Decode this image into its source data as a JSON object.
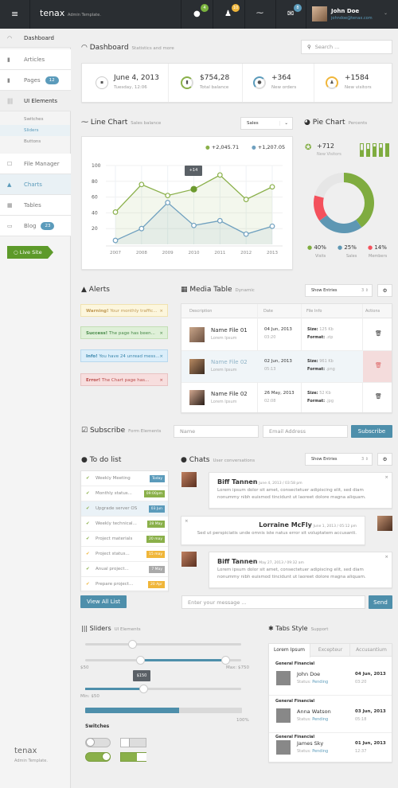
{
  "topbar": {
    "brand": "tenax",
    "brand_sub": "Admin Template.",
    "notif_badges": [
      "4",
      "10",
      "",
      "8"
    ],
    "user_name": "John Doe",
    "user_email": "johndoe@tenax.com"
  },
  "sidebar": {
    "items": [
      {
        "label": "Dashboard"
      },
      {
        "label": "Articles"
      },
      {
        "label": "Pages",
        "badge": "12"
      },
      {
        "label": "UI Elements"
      },
      {
        "label": "File Manager"
      },
      {
        "label": "Charts"
      },
      {
        "label": "Tables"
      },
      {
        "label": "Blog",
        "badge": "23"
      }
    ],
    "subitems": [
      "Switches",
      "Sliders",
      "Buttons"
    ],
    "live_site": "Live Site",
    "footer_brand": "tenax",
    "footer_sub": "Admin Template."
  },
  "dashboard": {
    "title": "Dashboard",
    "subtitle": "Statistics and more",
    "search_placeholder": "Search ...",
    "stats": [
      {
        "value": "June 4, 2013",
        "label": "Tuesday, 12:06"
      },
      {
        "value": "$754,28",
        "label": "Total balance"
      },
      {
        "value": "+364",
        "label": "New orders"
      },
      {
        "value": "+1584",
        "label": "New visitors"
      }
    ]
  },
  "line_chart": {
    "title": "Line Chart",
    "subtitle": "Sales balance",
    "select": "Sales",
    "legend": [
      "+2,045.71",
      "+1,207.05"
    ],
    "tooltip": "+14"
  },
  "chart_data": {
    "type": "line",
    "x": [
      "2007",
      "2008",
      "2009",
      "2010",
      "2011",
      "2012",
      "2013"
    ],
    "yticks": [
      20,
      40,
      60,
      80,
      100
    ],
    "ylim": [
      0,
      100
    ],
    "series": [
      {
        "color": "#8ab04a",
        "values": [
          41,
          76,
          62,
          70,
          88,
          57,
          73
        ]
      },
      {
        "color": "#6fa0bf",
        "values": [
          5,
          20,
          53,
          24,
          30,
          13,
          23
        ]
      }
    ],
    "highlight": {
      "series": 0,
      "index": 3
    }
  },
  "pie_chart": {
    "title": "Pie Chart",
    "subtitle": "Percents",
    "visitors_value": "+712",
    "visitors_label": "New Visitors",
    "mini_bars": [
      0.5,
      0.6,
      0.8,
      0.7,
      1.0
    ],
    "slices": [
      {
        "label": "Visits",
        "percent": 40,
        "text": "40%",
        "color": "#7fac3f"
      },
      {
        "label": "Sales",
        "percent": 25,
        "text": "25%",
        "color": "#5e97b3"
      },
      {
        "label": "Members",
        "percent": 14,
        "text": "14%",
        "color": "#f4515c"
      },
      {
        "label": "",
        "percent": 21,
        "color": "#e6e6e6"
      }
    ]
  },
  "alerts": {
    "title": "Alerts",
    "items": [
      {
        "strong": "Warning!",
        "text": " Your monthly traffic..."
      },
      {
        "strong": "Success!",
        "text": " The page has been..."
      },
      {
        "strong": "Info!",
        "text": " You have 24 unread mess..."
      },
      {
        "strong": "Error!",
        "text": " The Chart page has..."
      }
    ]
  },
  "media_table": {
    "title": "Media Table",
    "subtitle": "Dynamic",
    "show_entries": "Show Entries",
    "entries": "3",
    "columns": [
      "Description",
      "Date",
      "File Info",
      "Actions"
    ],
    "rows": [
      {
        "name": "Name File 01",
        "sub": "Lorem Ipsum",
        "date": "04 Jun, 2013",
        "time": "03:20",
        "size": "125 Kb",
        "format": ".zip"
      },
      {
        "name": "Name File 02",
        "sub": "Lorem Ipsum",
        "date": "02 Jun, 2013",
        "time": "05:13",
        "size": "961 Kb",
        "format": ".png"
      },
      {
        "name": "Name File 02",
        "sub": "Lorem Ipsum",
        "date": "26 May, 2013",
        "time": "02:08",
        "size": "52 Kb",
        "format": ".jpg"
      }
    ],
    "size_label": "Size:",
    "format_label": "Format:"
  },
  "subscribe": {
    "title": "Subscribe",
    "subtitle": "Form Elements",
    "name_placeholder": "Name",
    "email_placeholder": "Email Address",
    "button": "Subscribe"
  },
  "todo": {
    "title": "To do list",
    "button": "View All List",
    "items": [
      {
        "text": "Weekly Meeting",
        "badge": "Today",
        "color": "#5b9bbb"
      },
      {
        "text": "Monthly status...",
        "badge": "09:00pm",
        "color": "#8ab04a"
      },
      {
        "text": "Upgrade server OS",
        "badge": "03 Jun",
        "color": "#5b9bbb"
      },
      {
        "text": "Weekly technical...",
        "badge": "28 May",
        "color": "#8ab04a"
      },
      {
        "text": "Project materials",
        "badge": "20 may",
        "color": "#8ab04a"
      },
      {
        "text": "Project status...",
        "badge": "15 may",
        "color": "#f0b63a"
      },
      {
        "text": "Anual project...",
        "badge": "7 May",
        "color": "#aaa"
      },
      {
        "text": "Prepare project...",
        "badge": "20 Apr",
        "color": "#f0b63a"
      }
    ]
  },
  "chats": {
    "title": "Chats",
    "subtitle": "User conversations",
    "show_entries": "Show Entries",
    "entries": "3",
    "input_placeholder": "Enter your message ...",
    "send": "Send",
    "messages": [
      {
        "name": "Biff Tannen",
        "meta": "June 4, 2013 / 03:58 pm",
        "text": "Lorem ipsum dolor sit amet, consectetuer adipiscing elit, sed diam nonummy nibh euismod tincidunt ut laoreet dolore magna aliquam."
      },
      {
        "name": "Lorraine McFly",
        "meta": "June 1, 2013 / 05:12 pm",
        "text": "Sed ut perspiciatis unde omnis iste natus error sit voluptatem accusanti."
      },
      {
        "name": "Biff Tannen",
        "meta": "May 27, 2013 / 09:32 am",
        "text": "Lorem ipsum dolor sit amet, consectetuer adipiscing elit, sed diam nonummy nibh euismod tincidunt ut laoreet dolore magna aliquam."
      }
    ]
  },
  "sliders": {
    "title": "Sliders",
    "subtitle": "UI Elements",
    "range_min": "$50",
    "range_max": "Max: $750",
    "tooltip": "$150",
    "min_label": "Min: $50",
    "progress": 0.6,
    "progress_label": "100%",
    "switches": "Switches",
    "single_value": 0.3,
    "range_values": [
      0.35,
      0.9
    ],
    "min_value": 0.37
  },
  "tabs": {
    "title": "Tabs Style",
    "subtitle": "Support",
    "tabs": [
      "Lorem Ipsum",
      "Excepteur",
      "Accusantium"
    ],
    "status_label": "Status:",
    "items": [
      {
        "group": "General Financial",
        "name": "John Doe",
        "status": "Pending",
        "date": "04 Jun, 2013",
        "time": "03:20"
      },
      {
        "group": "General Financial",
        "name": "Anna Watson",
        "status": "Pending",
        "date": "03 Jun, 2013",
        "time": "05:18"
      },
      {
        "group": "General Financial",
        "name": "James Sky",
        "status": "Pending",
        "date": "01 Jun, 2013",
        "time": "12:37"
      }
    ]
  }
}
